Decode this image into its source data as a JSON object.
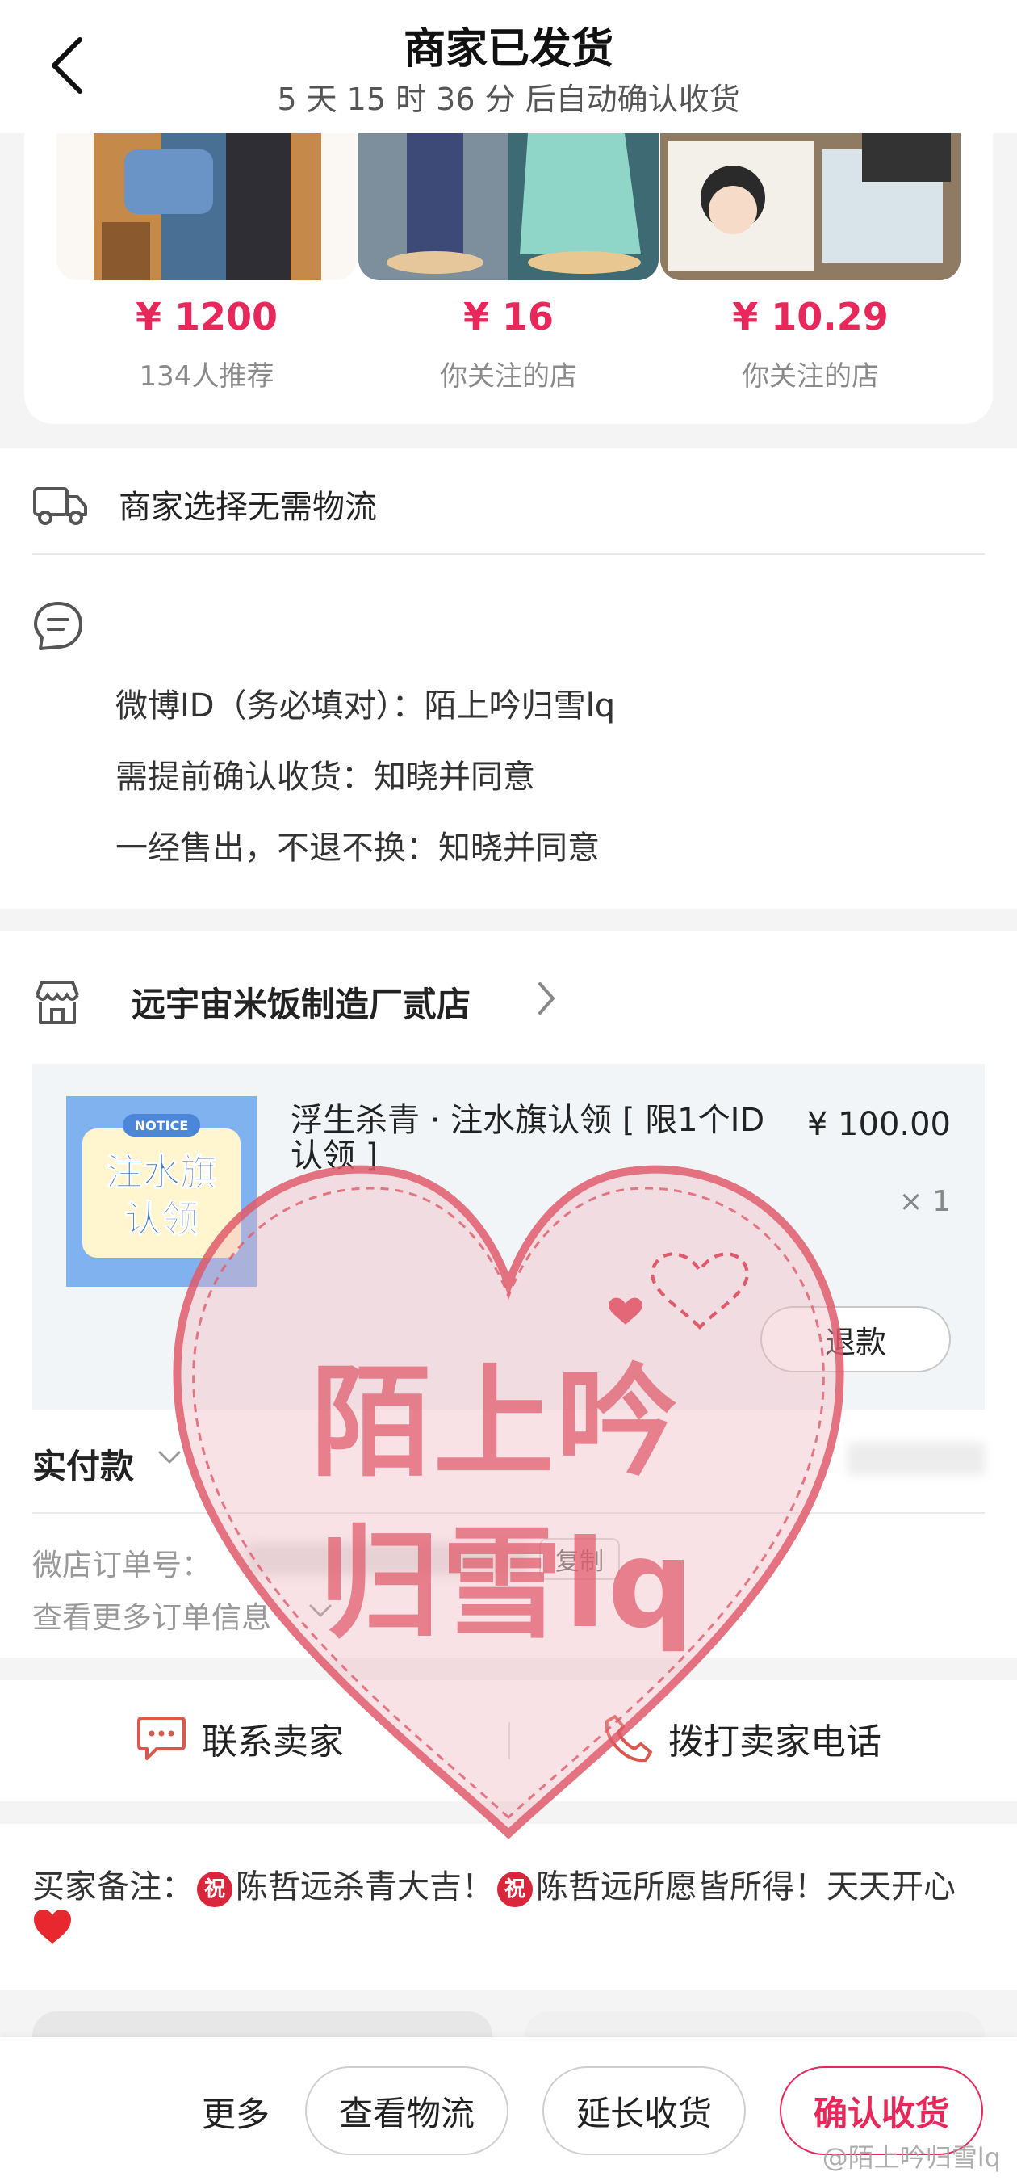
{
  "header": {
    "title": "商家已发货",
    "subtitle": "5 天 15 时 36 分  后自动确认收货"
  },
  "recommendations": [
    {
      "price": "¥ 1200",
      "note": "134人推荐"
    },
    {
      "price": "¥ 16",
      "note": "你关注的店"
    },
    {
      "price": "¥ 10.29",
      "note": "你关注的店"
    }
  ],
  "logistics": {
    "text": "商家选择无需物流"
  },
  "form": {
    "lines": [
      "微博ID（务必填对）：陌上吟归雪lq",
      "需提前确认收货：知晓并同意",
      "一经售出，不退不换：知晓并同意"
    ]
  },
  "shop": {
    "name": "远宇宙米饭制造厂贰店"
  },
  "product": {
    "title": "浮生杀青 · 注水旗认领 [ 限1个ID认领 ]",
    "price": "¥ 100.00",
    "qty": "× 1",
    "image_text": "注水旗认领",
    "image_badge": "NOTICE",
    "refund_label": "退款"
  },
  "order": {
    "paid_label": "实付款",
    "order_no_label": "微店订单号：",
    "copy_label": "复制",
    "more_info_label": "查看更多订单信息"
  },
  "contact": {
    "chat_label": "联系卖家",
    "call_label": "拨打卖家电话"
  },
  "buyer_note": {
    "label": "买家备注：",
    "badge": "祝",
    "part1": "陈哲远杀青大吉！",
    "part2": "陈哲远所愿皆所得！天天开心"
  },
  "bottom_bar": {
    "more": "更多",
    "logistics": "查看物流",
    "extend": "延长收货",
    "confirm": "确认收货"
  },
  "watermark": {
    "line1": "陌上吟",
    "line2": "归雪lq",
    "corner": "@陌上吟归雪lq"
  },
  "colors": {
    "accent": "#e8285a",
    "stamp": "#e15a6a",
    "icon_red": "#d9574c"
  }
}
